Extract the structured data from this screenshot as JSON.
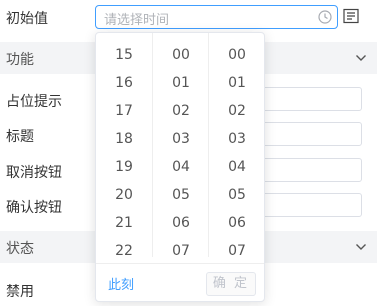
{
  "initial_value": {
    "label": "初始值",
    "placeholder": "请选择时间"
  },
  "sections": {
    "function_title": "功能",
    "state_title": "状态"
  },
  "properties": [
    {
      "label": "占位提示"
    },
    {
      "label": "标题"
    },
    {
      "label": "取消按钮"
    },
    {
      "label": "确认按钮"
    }
  ],
  "state_properties": [
    {
      "label": "禁用"
    }
  ],
  "picker": {
    "hours": [
      "15",
      "16",
      "17",
      "18",
      "19",
      "20",
      "21",
      "22"
    ],
    "minutes": [
      "00",
      "01",
      "02",
      "03",
      "04",
      "05",
      "06",
      "07"
    ],
    "seconds": [
      "00",
      "01",
      "02",
      "03",
      "04",
      "05",
      "06",
      "07"
    ],
    "now_label": "此刻",
    "confirm_label": "确 定"
  },
  "colors": {
    "accent": "#409eff",
    "section_bg": "#f3f4f6",
    "placeholder": "#b0b3b8",
    "disabled_text": "#c0c4cc"
  },
  "icons": {
    "input_suffix": "clock-icon",
    "text_mode": "text-lines-icon",
    "section_toggle": "chevron-down-icon"
  }
}
